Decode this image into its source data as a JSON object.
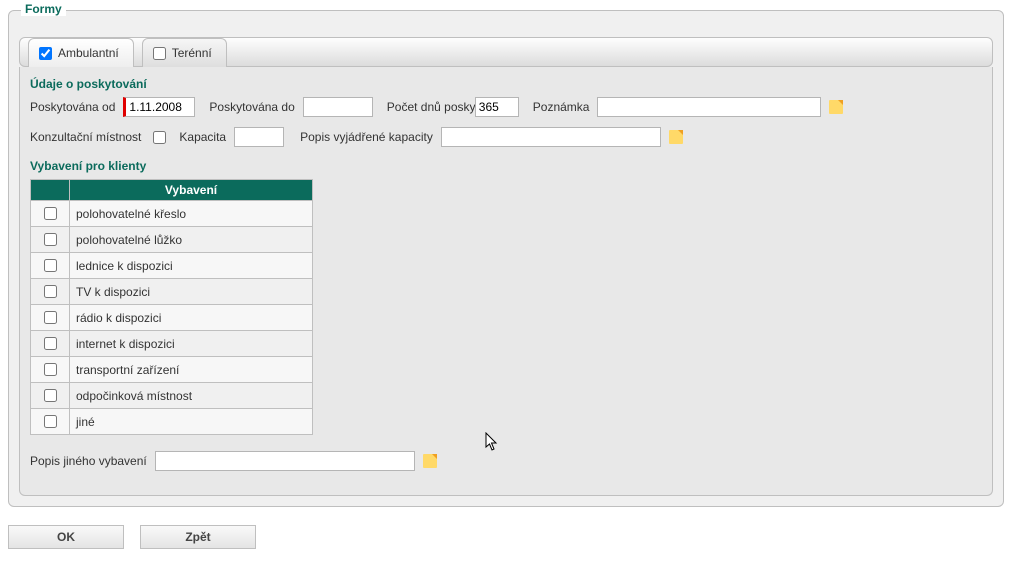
{
  "section": {
    "title": "Formy"
  },
  "tabs": {
    "ambulantni": {
      "label": "Ambulantní",
      "checked": true
    },
    "terenni": {
      "label": "Terénní",
      "checked": false
    }
  },
  "udaje": {
    "legend": "Údaje o poskytování",
    "poskytovana_od_label": "Poskytována od",
    "poskytovana_od_value": "1.11.2008",
    "poskytovana_do_label": "Poskytována do",
    "poskytovana_do_value": "",
    "pocet_dnu_label": "Počet dnů poskytování",
    "pocet_dnu_value": "365",
    "poznamka_label": "Poznámka",
    "poznamka_value": "",
    "konzultacni_label": "Konzultační místnost",
    "konzultacni_checked": false,
    "kapacita_label": "Kapacita",
    "kapacita_value": "",
    "popis_kap_label": "Popis vyjádřené kapacity",
    "popis_kap_value": ""
  },
  "vybaveni": {
    "legend": "Vybavení pro klienty",
    "col_header": "Vybavení",
    "items": [
      {
        "label": "polohovatelné křeslo",
        "checked": false
      },
      {
        "label": "polohovatelné lůžko",
        "checked": false
      },
      {
        "label": "lednice k dispozici",
        "checked": false
      },
      {
        "label": "TV k dispozici",
        "checked": false
      },
      {
        "label": "rádio k dispozici",
        "checked": false
      },
      {
        "label": "internet k dispozici",
        "checked": false
      },
      {
        "label": "transportní zařízení",
        "checked": false
      },
      {
        "label": "odpočinková místnost",
        "checked": false
      },
      {
        "label": "jiné",
        "checked": false
      }
    ],
    "other_label": "Popis jiného vybavení",
    "other_value": ""
  },
  "buttons": {
    "ok": "OK",
    "back": "Zpět"
  }
}
